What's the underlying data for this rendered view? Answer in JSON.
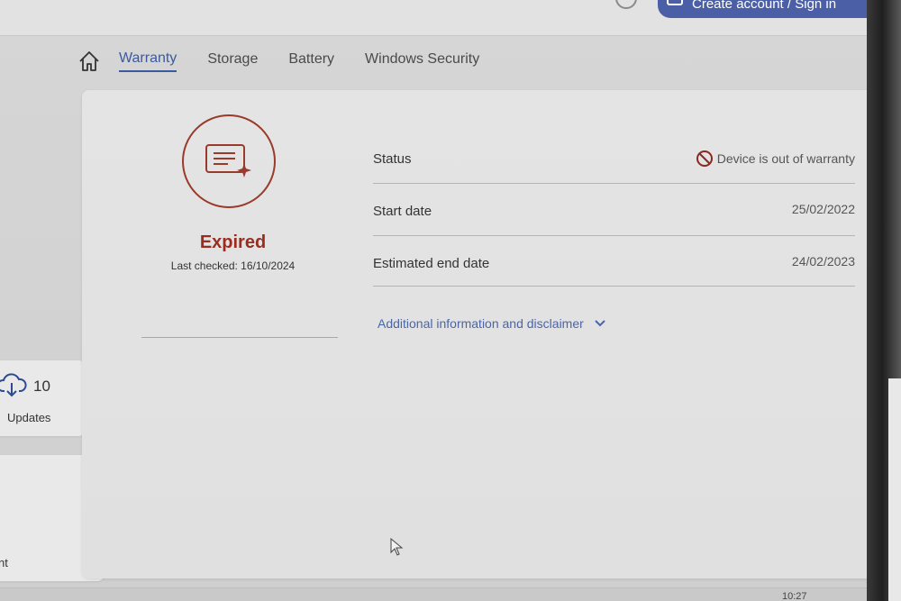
{
  "header": {
    "account_label": "Create account / Sign in"
  },
  "tabs": [
    {
      "label": "Warranty",
      "active": true
    },
    {
      "label": "Storage",
      "active": false
    },
    {
      "label": "Battery",
      "active": false
    },
    {
      "label": "Windows Security",
      "active": false
    }
  ],
  "sidebar": {
    "updates_count": "10",
    "updates_label": "Updates",
    "second_card_label": "nt"
  },
  "warranty": {
    "state": "Expired",
    "last_checked": "Last checked: 16/10/2024",
    "rows": [
      {
        "label": "Status",
        "value": "Device is out of warranty",
        "icon": "prohibited-icon"
      },
      {
        "label": "Start date",
        "value": "25/02/2022"
      },
      {
        "label": "Estimated end date",
        "value": "24/02/2023"
      }
    ],
    "more_info": "Additional information and disclaimer"
  },
  "taskbar": {
    "clock": "10:27"
  },
  "colors": {
    "accent": "#3b5a9e",
    "expired": "#9a2d1f",
    "account_button": "#4b5fa6"
  }
}
